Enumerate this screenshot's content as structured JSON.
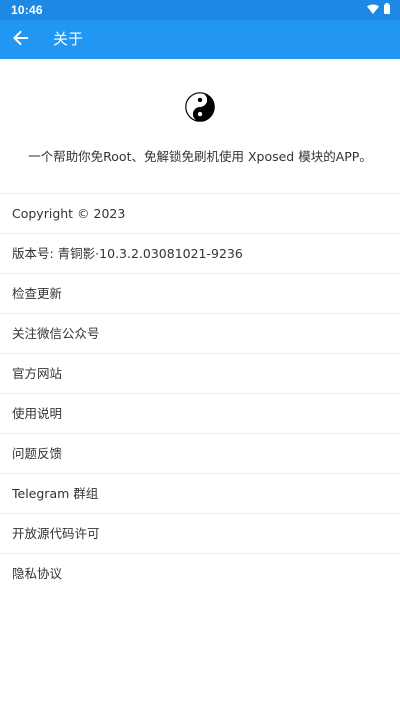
{
  "status_bar": {
    "time": "10:46",
    "icons": [
      "wifi-icon",
      "battery-icon"
    ]
  },
  "app_bar": {
    "title": "关于",
    "back_icon": "arrow-left-icon"
  },
  "header": {
    "logo_icon": "yin-yang-icon",
    "description": "一个帮助你免Root、免解锁免刷机使用 Xposed 模块的APP。"
  },
  "list": {
    "copyright": "Copyright © 2023",
    "version": "版本号: 青铜影·10.3.2.03081021-9236",
    "check_update": "检查更新",
    "follow_wechat": "关注微信公众号",
    "website": "官方网站",
    "instructions": "使用说明",
    "feedback": "问题反馈",
    "telegram": "Telegram 群组",
    "open_source": "开放源代码许可",
    "privacy": "隐私协议"
  },
  "colors": {
    "status_bar": "#1e88e5",
    "app_bar": "#2196f3",
    "divider": "#eeeeee",
    "text": "#333333"
  }
}
